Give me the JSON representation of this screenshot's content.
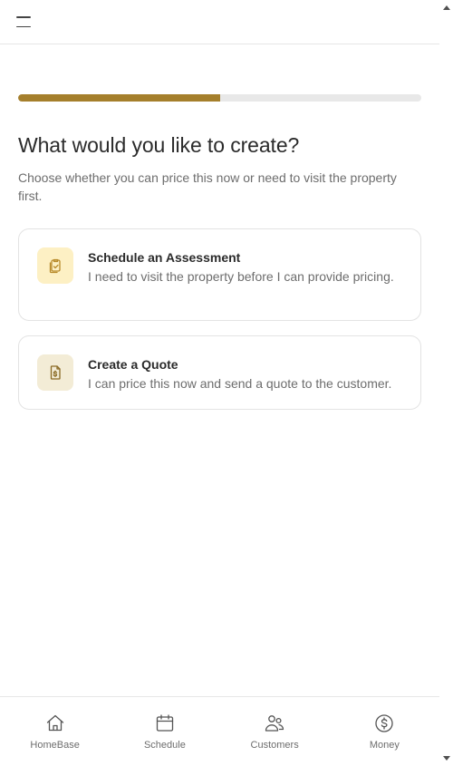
{
  "header": {
    "menu_icon": "hamburger-menu-icon"
  },
  "progress": {
    "value_percent": 50,
    "fill_color": "#a57f2c"
  },
  "page": {
    "title": "What would you like to create?",
    "subtitle": "Choose whether you can price this now or need to visit the property first."
  },
  "options": [
    {
      "title": "Schedule an Assessment",
      "description": "I need to visit the property before I can provide pricing.",
      "icon": "clipboard-check-icon"
    },
    {
      "title": "Create a Quote",
      "description": "I can price this now and send a quote to the customer.",
      "icon": "dollar-document-icon"
    }
  ],
  "nav": {
    "items": [
      {
        "label": "HomeBase",
        "icon": "home-icon"
      },
      {
        "label": "Schedule",
        "icon": "calendar-icon"
      },
      {
        "label": "Customers",
        "icon": "users-icon"
      },
      {
        "label": "Money",
        "icon": "dollar-circle-icon"
      }
    ]
  },
  "colors": {
    "accent": "#a57f2c",
    "assessment_bg": "#fdf0c4",
    "quote_bg": "#f3ecd6"
  }
}
